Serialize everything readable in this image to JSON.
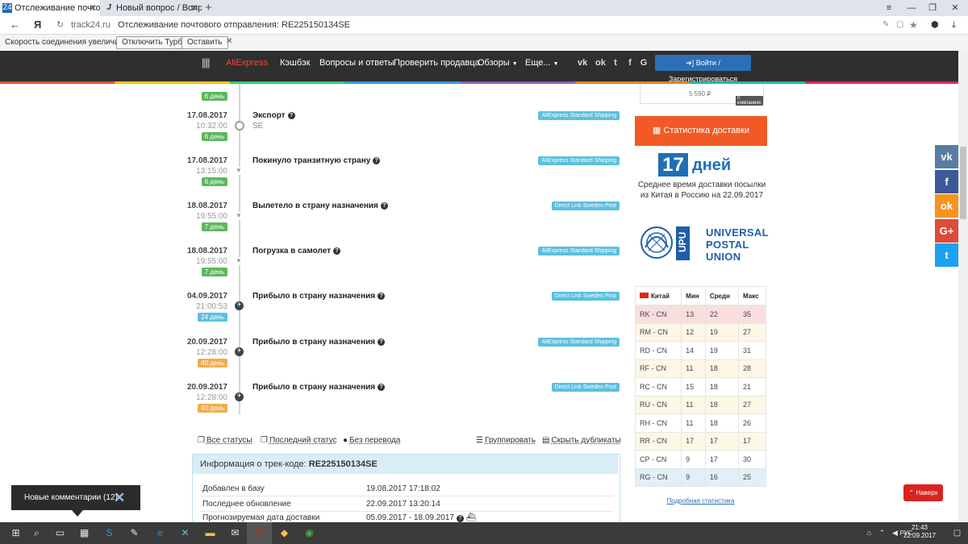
{
  "browser": {
    "tabs": [
      {
        "title": "Отслеживание почтовог",
        "icon": "24"
      },
      {
        "title": "Новый вопрос / Вопросы и",
        "icon": "J"
      }
    ],
    "host": "track24.ru",
    "page_title": "Отслеживание почтового отправления: RE225150134SE",
    "turbo_message": "Скорость соединения увеличилась.",
    "turbo_disable": "Отключить Турбо",
    "turbo_keep": "Оставить"
  },
  "site": {
    "brand": "AliExpress",
    "nav": [
      "Кэшбэк",
      "Вопросы и ответы",
      "Проверить продавца",
      "Обзоры",
      "Еще..."
    ],
    "login": "Войти / Зарегистрироваться"
  },
  "events": [
    {
      "date": "",
      "time": "",
      "days": "6 день",
      "days_color": "green",
      "title": "",
      "sub": "",
      "service": "",
      "marker": "gray"
    },
    {
      "date": "17.08.2017",
      "time": "10:32:00",
      "days": "6 день",
      "days_color": "green",
      "title": "Экспорт",
      "sub": "SE",
      "service": "AliExpress Standard Shipping",
      "marker": "gray"
    },
    {
      "date": "17.08.2017",
      "time": "13:15:00",
      "days": "6 день",
      "days_color": "green",
      "title": "Покинуло транзитную страну",
      "sub": "",
      "service": "AliExpress Standard Shipping",
      "marker": "arrow"
    },
    {
      "date": "18.08.2017",
      "time": "19:55:00",
      "days": "7 день",
      "days_color": "green",
      "title": "Вылетело в страну назначения",
      "sub": "",
      "service": "Direct Link Sweden Post",
      "marker": "arrow"
    },
    {
      "date": "18.08.2017",
      "time": "19:55:00",
      "days": "7 день",
      "days_color": "green",
      "title": "Погрузка в самолет",
      "sub": "",
      "service": "AliExpress Standard Shipping",
      "marker": "arrow"
    },
    {
      "date": "04.09.2017",
      "time": "21:00:53",
      "days": "24 день",
      "days_color": "blue",
      "title": "Прибыло в страну назначения",
      "sub": "",
      "service": "Direct Link Sweden Post",
      "marker": "dark"
    },
    {
      "date": "20.09.2017",
      "time": "12:28:00",
      "days": "40 день",
      "days_color": "orange",
      "title": "Прибыло в страну назначения",
      "sub": "",
      "service": "AliExpress Standard Shipping",
      "marker": "dark"
    },
    {
      "date": "20.09.2017",
      "time": "12:28:00",
      "days": "40 день",
      "days_color": "orange",
      "title": "Прибыло в страну назначения",
      "sub": "",
      "service": "Direct Link Sweden Post",
      "marker": "dark"
    }
  ],
  "controls": {
    "all_statuses": "Все статусы",
    "last_status": "Последний статус",
    "no_translation": "Без перевода",
    "group": "Группировать",
    "hide_duplicates": "Скрыть дубликаты"
  },
  "info": {
    "heading": "Информация о трек-коде:",
    "code": "RE225150134SE",
    "rows": [
      {
        "label": "Добавлен в базу",
        "value": "19.08.2017 17:18:02"
      },
      {
        "label": "Последнее обновление",
        "value": "22.09.2017 13:20:14"
      },
      {
        "label": "Прогнозируемая дата доставки",
        "value": "05.09.2017 - 18.09.2017"
      }
    ]
  },
  "sidebar": {
    "price": "5 590 ₽",
    "price_note": "0 компаниях",
    "stats_button": "Статистика доставки",
    "days_number": "17",
    "days_word": "дней",
    "days_caption": "Среднее время доставки посылки из Китая в Россию на 22.09.2017",
    "upu_abbr": "UPU",
    "upu_lines": [
      "UNIVERSAL",
      "POSTAL",
      "UNION"
    ],
    "table_header": [
      "Китай",
      "Мин",
      "Средн",
      "Макс"
    ],
    "table_rows": [
      [
        "RK - CN",
        "13",
        "22",
        "35"
      ],
      [
        "RM - CN",
        "12",
        "19",
        "27"
      ],
      [
        "RD - CN",
        "14",
        "19",
        "31"
      ],
      [
        "RF - CN",
        "11",
        "18",
        "28"
      ],
      [
        "RC - CN",
        "15",
        "18",
        "21"
      ],
      [
        "RU - CN",
        "11",
        "18",
        "27"
      ],
      [
        "RH - CN",
        "11",
        "18",
        "26"
      ],
      [
        "RR - CN",
        "17",
        "17",
        "17"
      ],
      [
        "CP - CN",
        "9",
        "17",
        "30"
      ],
      [
        "RG - CN",
        "9",
        "16",
        "25"
      ]
    ],
    "more_stats": "Подробная статистика"
  },
  "social": [
    {
      "icon": "vk-icon",
      "color": "#587ca3"
    },
    {
      "icon": "facebook-icon",
      "color": "#3b5998"
    },
    {
      "icon": "odnoklassniki-icon",
      "color": "#f7931e"
    },
    {
      "icon": "google-plus-icon",
      "color": "#dd4b39"
    },
    {
      "icon": "twitter-icon",
      "color": "#1da1f2"
    }
  ],
  "back_to_top": "Наверх",
  "comments_popup": "Новые комментарии (12)",
  "taskbar": {
    "lang": "РУС",
    "time": "21:43",
    "date": "22.09.2017"
  }
}
